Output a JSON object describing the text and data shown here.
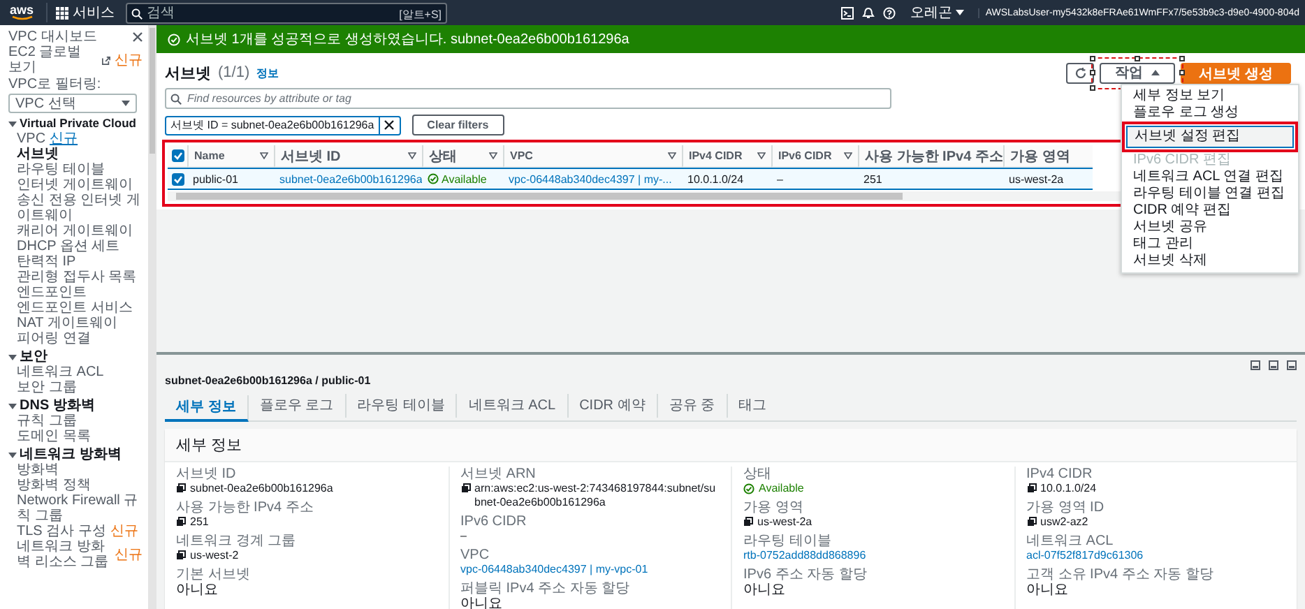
{
  "top_bar": {
    "logo": "aws",
    "services": "서비스",
    "search": {
      "placeholder": "검색",
      "shortcut": "[알트+S]"
    },
    "region": "오레곤",
    "account": "AWSLabsUser-my5432k8eFRAe61WmFFx7/5e53b9c3-d9e0-4900-804d"
  },
  "sidebar": {
    "top_items": [
      {
        "label": "VPC 대시보드",
        "kind": "close"
      },
      {
        "label": "EC2 글로벌 보기",
        "kind": "external",
        "badge": {
          "text": "신규",
          "color": "#ec7211"
        }
      }
    ],
    "filter": {
      "label": "VPC로 필터링:",
      "value": "VPC 선택"
    },
    "sections": [
      {
        "title": "Virtual Private Cloud",
        "expanded": true,
        "items": [
          {
            "label": "VPC",
            "badge": {
              "text": "신규",
              "color": "#0073bb"
            },
            "selected": false
          },
          {
            "label": "서브넷",
            "selected": true
          },
          {
            "label": "라우팅 테이블",
            "selected": false
          },
          {
            "label": "인터넷 게이트웨이",
            "selected": false
          },
          {
            "label": "송신 전용 인터넷 게이트웨이",
            "selected": false
          },
          {
            "label": "캐리어 게이트웨이",
            "selected": false
          },
          {
            "label": "DHCP 옵션 세트",
            "selected": false
          },
          {
            "label": "탄력적 IP",
            "selected": false
          },
          {
            "label": "관리형 접두사 목록",
            "selected": false
          },
          {
            "label": "엔드포인트",
            "selected": false
          },
          {
            "label": "엔드포인트 서비스",
            "selected": false
          },
          {
            "label": "NAT 게이트웨이",
            "selected": false
          },
          {
            "label": "피어링 연결",
            "selected": false
          }
        ]
      },
      {
        "title": "보안",
        "expanded": true,
        "items": [
          {
            "label": "네트워크 ACL",
            "selected": false
          },
          {
            "label": "보안 그룹",
            "selected": false
          }
        ]
      },
      {
        "title": "DNS 방화벽",
        "expanded": true,
        "items": [
          {
            "label": "규칙 그룹",
            "selected": false
          },
          {
            "label": "도메인 목록",
            "selected": false
          }
        ]
      },
      {
        "title": "네트워크 방화벽",
        "expanded": true,
        "items": [
          {
            "label": "방화벽",
            "selected": false
          },
          {
            "label": "방화벽 정책",
            "selected": false
          },
          {
            "label": "Network Firewall 규칙 그룹",
            "selected": false
          },
          {
            "label": "TLS 검사 구성",
            "badge": {
              "text": "신규",
              "color": "#ec7211"
            },
            "selected": false
          },
          {
            "label": "네트워크 방화벽 리소스 그룹",
            "badge": {
              "text": "신규",
              "color": "#ec7211"
            },
            "selected": false
          }
        ]
      }
    ]
  },
  "flash": {
    "kind": "success",
    "message": "서브넷 1개를 성공적으로 생성하였습니다. subnet-0ea2e6b00b161296a"
  },
  "subnets_panel": {
    "title": "서브넷",
    "count": "(1/1)",
    "info": "정보",
    "actions_button": {
      "label": "작업",
      "expanded": true,
      "highlighted": true
    },
    "create_button": "서브넷 생성",
    "actions_menu": [
      {
        "label": "세부 정보 보기",
        "disabled": false,
        "highlighted": false
      },
      {
        "label": "플로우 로그 생성",
        "disabled": false,
        "highlighted": false
      },
      {
        "label": "서브넷 설정 편집",
        "disabled": false,
        "highlighted": true
      },
      {
        "label": "IPv6 CIDR 편집",
        "disabled": true,
        "highlighted": false
      },
      {
        "label": "네트워크 ACL 연결 편집",
        "disabled": false,
        "highlighted": false
      },
      {
        "label": "라우팅 테이블 연결 편집",
        "disabled": false,
        "highlighted": false
      },
      {
        "label": "CIDR 예약 편집",
        "disabled": false,
        "highlighted": false
      },
      {
        "label": "서브넷 공유",
        "disabled": false,
        "highlighted": false
      },
      {
        "label": "태그 관리",
        "disabled": false,
        "highlighted": false
      },
      {
        "label": "서브넷 삭제",
        "disabled": false,
        "highlighted": false
      }
    ],
    "search": {
      "placeholder": "Find resources by attribute or tag"
    },
    "filter_token": "서브넷 ID = subnet-0ea2e6b00b161296a",
    "clear_filters": "Clear filters",
    "table": {
      "highlighted": true,
      "all_checked": true,
      "columns": [
        "Name",
        "서브넷 ID",
        "상태",
        "VPC",
        "IPv4 CIDR",
        "IPv6 CIDR",
        "사용 가능한 IPv4 주소",
        "가용 영역"
      ],
      "rows": [
        {
          "checked": true,
          "selected": true,
          "cells": [
            {
              "text": "public-01",
              "kind": "text"
            },
            {
              "text": "subnet-0ea2e6b00b161296a",
              "kind": "link"
            },
            {
              "text": "Available",
              "kind": "status"
            },
            {
              "text": "vpc-06448ab340dec4397 | my-...",
              "kind": "link"
            },
            {
              "text": "10.0.1.0/24",
              "kind": "text"
            },
            {
              "text": "–",
              "kind": "text"
            },
            {
              "text": "251",
              "kind": "text"
            },
            {
              "text": "us-west-2a",
              "kind": "text"
            }
          ]
        }
      ]
    }
  },
  "details": {
    "title": "subnet-0ea2e6b00b161296a / public-01",
    "tabs": [
      {
        "label": "세부 정보",
        "selected": true
      },
      {
        "label": "플로우 로그",
        "selected": false
      },
      {
        "label": "라우팅 테이블",
        "selected": false
      },
      {
        "label": "네트워크 ACL",
        "selected": false
      },
      {
        "label": "CIDR 예약",
        "selected": false
      },
      {
        "label": "공유 중",
        "selected": false
      },
      {
        "label": "태그",
        "selected": false
      }
    ],
    "card_title": "세부 정보",
    "columns": [
      [
        {
          "label": "서브넷 ID",
          "value": "subnet-0ea2e6b00b161296a",
          "kind": "copy"
        },
        {
          "label": "사용 가능한 IPv4 주소",
          "value": "251",
          "kind": "copy"
        },
        {
          "label": "네트워크 경계 그룹",
          "value": "us-west-2",
          "kind": "copy"
        },
        {
          "label": "기본 서브넷",
          "value": "아니요",
          "kind": "text"
        }
      ],
      [
        {
          "label": "서브넷 ARN",
          "value": "arn:aws:ec2:us-west-2:743468197844:subnet/subnet-0ea2e6b00b161296a",
          "kind": "copy"
        },
        {
          "label": "IPv6 CIDR",
          "value": "–",
          "kind": "text"
        },
        {
          "label": "VPC",
          "value": "vpc-06448ab340dec4397 | my-vpc-01",
          "kind": "link"
        },
        {
          "label": "퍼블릭 IPv4 주소 자동 할당",
          "value": "아니요",
          "kind": "text"
        }
      ],
      [
        {
          "label": "상태",
          "value": "Available",
          "kind": "status"
        },
        {
          "label": "가용 영역",
          "value": "us-west-2a",
          "kind": "copy"
        },
        {
          "label": "라우팅 테이블",
          "value": "rtb-0752add88dd868896",
          "kind": "link"
        },
        {
          "label": "IPv6 주소 자동 할당",
          "value": "아니요",
          "kind": "text"
        }
      ],
      [
        {
          "label": "IPv4 CIDR",
          "value": "10.0.1.0/24",
          "kind": "copy"
        },
        {
          "label": "가용 영역 ID",
          "value": "usw2-az2",
          "kind": "copy"
        },
        {
          "label": "네트워크 ACL",
          "value": "acl-07f52f817d9c61306",
          "kind": "link"
        },
        {
          "label": "고객 소유 IPv4 주소 자동 할당",
          "value": "아니요",
          "kind": "text"
        }
      ]
    ]
  }
}
